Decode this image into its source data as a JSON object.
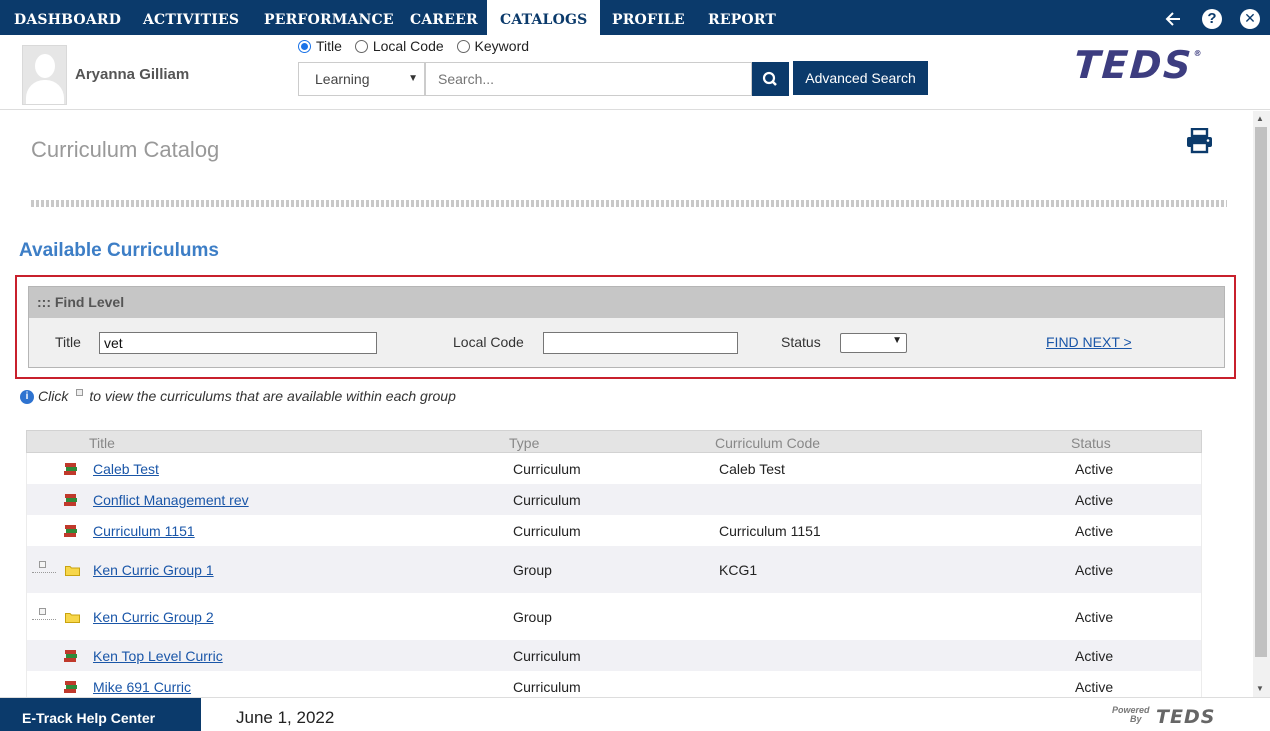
{
  "nav": {
    "items": [
      "DASHBOARD",
      "ACTIVITIES",
      "PERFORMANCE",
      "CAREER",
      "CATALOGS",
      "PROFILE",
      "REPORT"
    ],
    "active": "CATALOGS",
    "help_glyph": "?",
    "close_glyph": "✕"
  },
  "header": {
    "user_name": "Aryanna Gilliam",
    "radio_options": [
      "Title",
      "Local Code",
      "Keyword"
    ],
    "radio_selected": "Title",
    "catalog_select": "Learning",
    "search_placeholder": "Search...",
    "advanced_search": "Advanced Search",
    "logo_text": "TEDS",
    "logo_mark": "®"
  },
  "page": {
    "title": "Curriculum Catalog",
    "section_title": "Available Curriculums"
  },
  "find_level": {
    "heading": "::: Find Level",
    "title_label": "Title",
    "title_value": "vet",
    "local_code_label": "Local Code",
    "local_code_value": "",
    "status_label": "Status",
    "status_value": "",
    "find_next": "FIND NEXT >"
  },
  "hint": {
    "info_glyph": "i",
    "before": "Click",
    "after": "to view the curriculums that are available within each group"
  },
  "table": {
    "headers": [
      "Title",
      "Type",
      "Curriculum Code",
      "Status"
    ],
    "rows": [
      {
        "title": "Caleb Test",
        "type": "Curriculum",
        "code": "Caleb Test",
        "status": "Active",
        "kind": "curriculum"
      },
      {
        "title": "Conflict Management rev",
        "type": "Curriculum",
        "code": "",
        "status": "Active",
        "kind": "curriculum"
      },
      {
        "title": "Curriculum 1151",
        "type": "Curriculum",
        "code": "Curriculum 1151",
        "status": "Active",
        "kind": "curriculum"
      },
      {
        "title": "Ken Curric Group 1",
        "type": "Group",
        "code": "KCG1",
        "status": "Active",
        "kind": "group"
      },
      {
        "title": "Ken Curric Group 2",
        "type": "Group",
        "code": "",
        "status": "Active",
        "kind": "group"
      },
      {
        "title": "Ken Top Level Curric",
        "type": "Curriculum",
        "code": "",
        "status": "Active",
        "kind": "curriculum"
      },
      {
        "title": "Mike 691 Curric",
        "type": "Curriculum",
        "code": "",
        "status": "Active",
        "kind": "curriculum"
      }
    ]
  },
  "footer": {
    "help_center": "E-Track Help Center",
    "date": "June 1, 2022",
    "powered_line1": "Powered",
    "powered_line2": "By",
    "powered_logo": "TEDS"
  },
  "colors": {
    "nav_bg": "#0b3a6b",
    "accent_blue": "#3d7ec6",
    "link": "#1a56a8",
    "highlight_border": "#c8202c"
  }
}
